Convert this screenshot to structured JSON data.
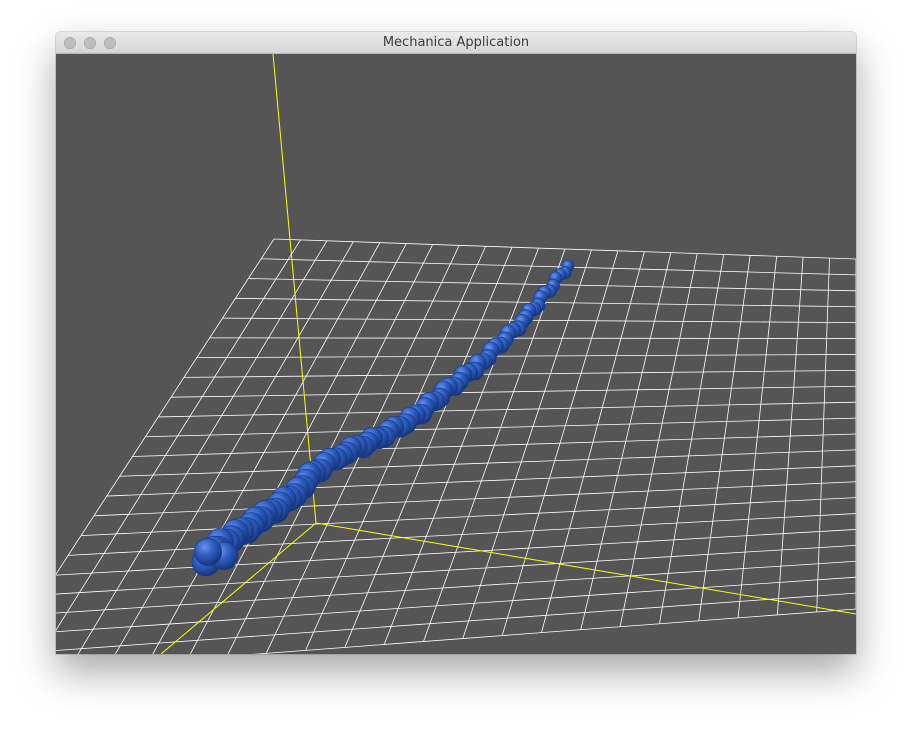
{
  "window": {
    "title": "Mechanica Application",
    "buttons": [
      "close",
      "minimize",
      "zoom"
    ]
  },
  "scene": {
    "background_color": "#555555",
    "grid_color": "#ffffff",
    "axis_color": "#ffff00",
    "particle_color": "#2f5fc4",
    "particle_highlight": "#5b86e0",
    "particle_shadow": "#173a8a"
  }
}
